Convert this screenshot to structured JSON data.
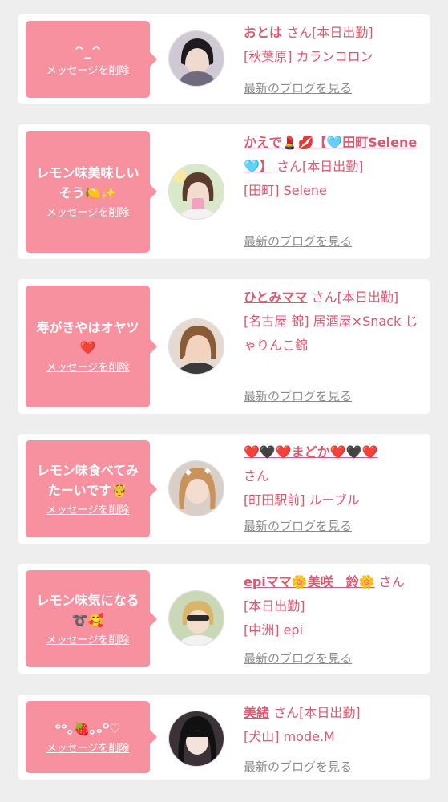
{
  "cards": [
    {
      "message": "^_^",
      "delete_label": "メッセージを削除",
      "name": "おとは",
      "suffix": "さん[本日出勤]",
      "shop": "[秋葉原] カランコロン",
      "blog_label": "最新のブログを見る"
    },
    {
      "message": "レモン味美味しいそう🍋✨",
      "delete_label": "メッセージを削除",
      "name": "かえで💄💋【🩵田町Selene🩵】",
      "suffix": "さん[本日出勤]",
      "shop": "[田町] Selene",
      "blog_label": "最新のブログを見る"
    },
    {
      "message": "寿がきやはオヤツ❤️",
      "delete_label": "メッセージを削除",
      "name": "ひとみママ",
      "suffix": "さん[本日出勤]",
      "shop": "[名古屋 錦] 居酒屋×Snack じゃりんこ錦",
      "blog_label": "最新のブログを見る"
    },
    {
      "message": "レモン味食べてみたーいです🤴",
      "delete_label": "メッセージを削除",
      "name": "❤️🖤❤️まどか❤️🖤❤️",
      "suffix": "さん",
      "shop": "[町田駅前] ルーブル",
      "blog_label": "最新のブログを見る"
    },
    {
      "message": "レモン味気になる➰🥰",
      "delete_label": "メッセージを削除",
      "name": "epiママ🌼美咲　鈴🌼",
      "suffix": "さん[本日出勤]",
      "shop": "[中洲] epi",
      "blog_label": "最新のブログを見る"
    },
    {
      "message": "ᵒᵒ｡🍓｡ₒᴼ♡",
      "delete_label": "メッセージを削除",
      "name": "美緒",
      "suffix": "さん[本日出勤]",
      "shop": "[犬山] mode.M",
      "blog_label": "最新のブログを見る"
    }
  ],
  "colors": {
    "background": "#eeeeee",
    "card": "#ffffff",
    "bubble": "#f8919f",
    "name": "#e0566e",
    "blog_link": "#8a8a8a"
  }
}
